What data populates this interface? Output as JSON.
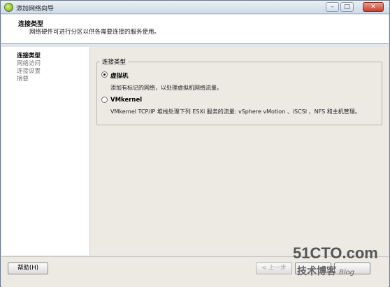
{
  "window": {
    "title": "添加网络向导",
    "controls": {
      "minimize": "–",
      "maximize": "□",
      "close": "✕"
    }
  },
  "header": {
    "title": "连接类型",
    "subtitle": "网络硬件可进行分区以供各需要连接的服务使用。"
  },
  "sidebar": {
    "items": [
      {
        "label": "连接类型",
        "active": true
      },
      {
        "label": "网络访问",
        "active": false
      },
      {
        "label": "连接设置",
        "active": false
      },
      {
        "label": "摘要",
        "active": false
      }
    ]
  },
  "main": {
    "group_title": "连接类型",
    "options": [
      {
        "label": "虚拟机",
        "description": "添加有标记的网络，以处理虚拟机网络流量。",
        "selected": true
      },
      {
        "label": "VMkernel",
        "description": "VMkernel TCP/IP 堆栈处理下列 ESXi 服务的流量: vSphere vMotion 、iSCSI 、NFS 和主机管理。",
        "selected": false
      }
    ]
  },
  "footer": {
    "help_label": "帮助(H)",
    "back_label": "< 上一步",
    "back_enabled": false
  },
  "watermark": {
    "site": "51CTO.com",
    "tagline": "技术博客",
    "blog": "Blog"
  }
}
